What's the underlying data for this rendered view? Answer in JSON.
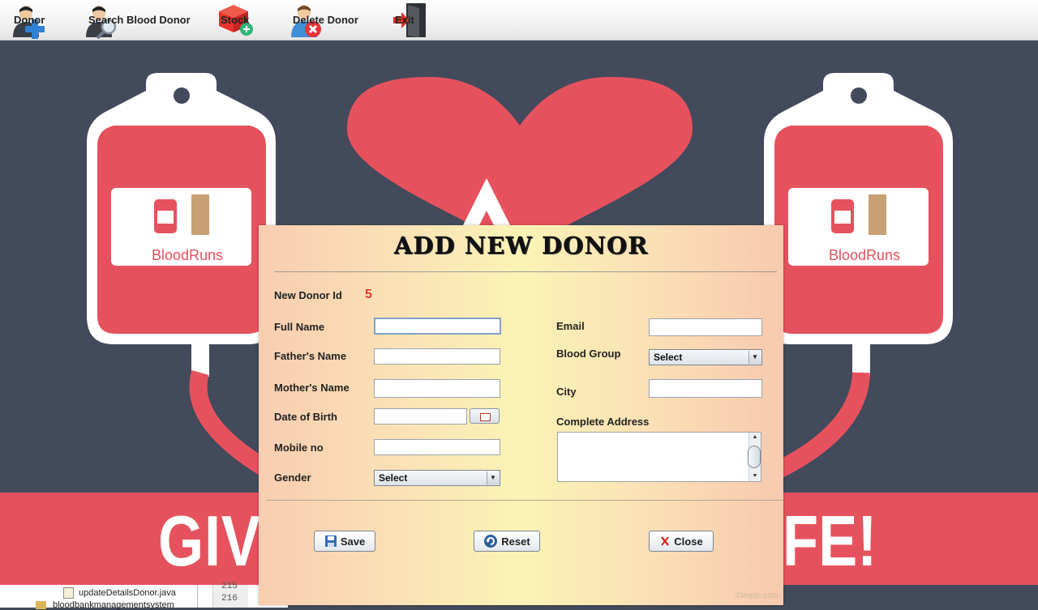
{
  "toolbar": {
    "items": [
      {
        "label": "Donor",
        "icon": "add-donor-icon"
      },
      {
        "label": "Search  Blood Donor",
        "icon": "search-donor-icon"
      },
      {
        "label": "Stock",
        "icon": "stock-icon"
      },
      {
        "label": "Delete Donor",
        "icon": "delete-donor-icon"
      },
      {
        "label": "Exit",
        "icon": "exit-door-icon"
      }
    ]
  },
  "background": {
    "brand": "BloodRuns",
    "banner_left": "GIV",
    "banner_right": "FE!",
    "colors": {
      "dark": "#424a5b",
      "red": "#e5525d",
      "white": "#ffffff"
    }
  },
  "ide": {
    "tree_items": [
      "updateDetailsDonor.java",
      "bloodbankmanagementsystem"
    ],
    "line_numbers": [
      "215",
      "216"
    ]
  },
  "dialog": {
    "title": "ADD NEW DONOR",
    "new_donor_id_label": "New Donor Id",
    "new_donor_id_value": "5",
    "fields": {
      "full_name": {
        "label": "Full Name",
        "value": ""
      },
      "fathers_name": {
        "label": "Father's Name",
        "value": ""
      },
      "mothers_name": {
        "label": "Mother's Name",
        "value": ""
      },
      "dob": {
        "label": "Date of Birth",
        "value": ""
      },
      "mobile": {
        "label": "Mobile no",
        "value": ""
      },
      "gender": {
        "label": "Gender",
        "selected": "Select"
      },
      "email": {
        "label": "Email",
        "value": ""
      },
      "blood_group": {
        "label": "Blood Group",
        "selected": "Select"
      },
      "city": {
        "label": "City",
        "value": ""
      },
      "address": {
        "label": "Complete Address",
        "value": ""
      }
    },
    "buttons": {
      "save": "Save",
      "reset": "Reset",
      "close": "Close"
    },
    "watermark": "©imple.com"
  }
}
